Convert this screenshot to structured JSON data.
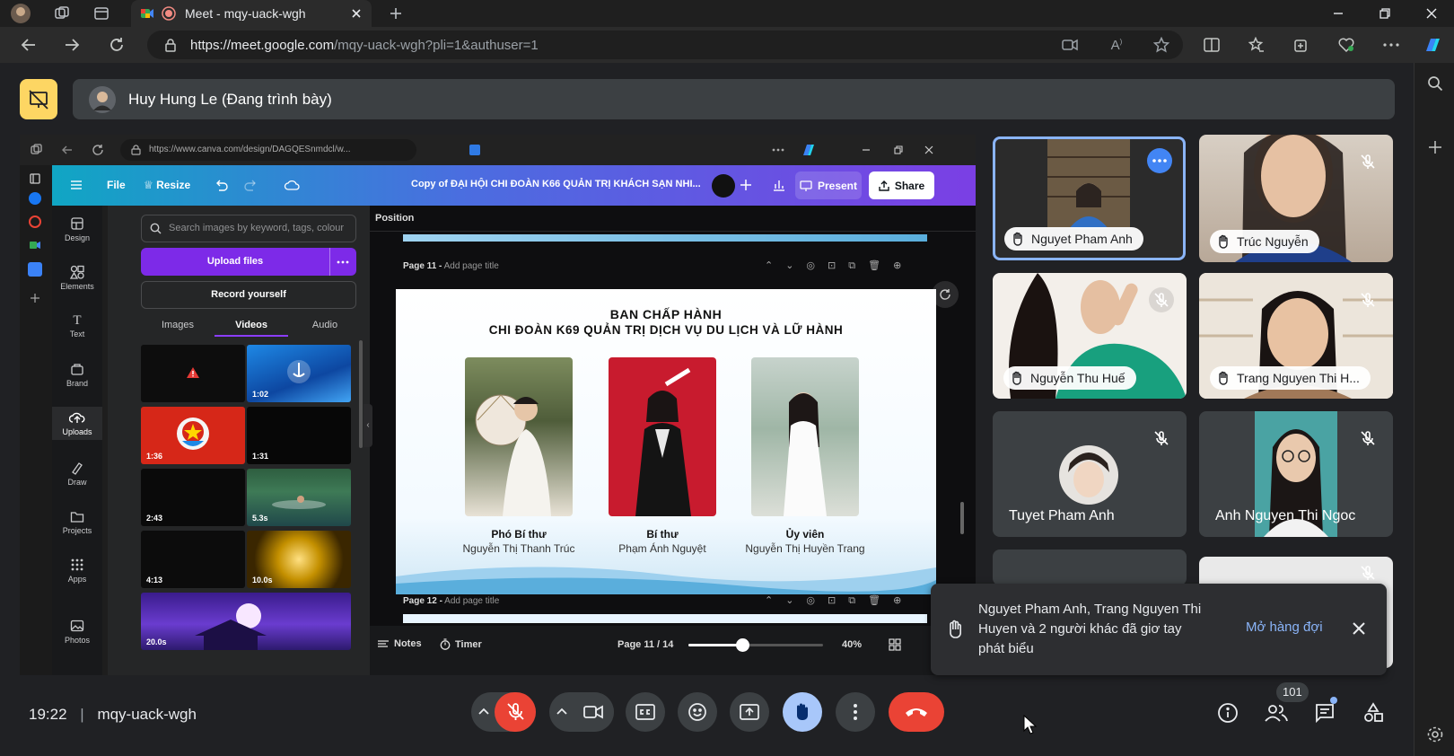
{
  "browser": {
    "tab_title": "Meet - mqy-uack-wgh",
    "url_host": "https://meet.google.com",
    "url_path": "/mqy-uack-wgh?pli=1&authuser=1"
  },
  "meet": {
    "presenter_label": "Huy Hung Le (Đang trình bày)",
    "time": "19:22",
    "separator": "|",
    "meeting_code": "mqy-uack-wgh",
    "participant_count": "101"
  },
  "canva": {
    "url": "https://www.canva.com/design/DAGQESnmdcl/w...",
    "menu": {
      "file": "File",
      "resize": "Resize"
    },
    "doc_title": "Copy of ĐẠI HỘI CHI ĐOÀN K66 QUẢN TRỊ KHÁCH SẠN NHI...",
    "present_label": "Present",
    "share_label": "Share",
    "sidebar": [
      "Design",
      "Elements",
      "Text",
      "Brand",
      "Uploads",
      "Draw",
      "Projects",
      "Apps",
      "Photos"
    ],
    "search_placeholder": "Search images by keyword, tags, colour",
    "upload_label": "Upload files",
    "record_label": "Record yourself",
    "tabs": [
      "Images",
      "Videos",
      "Audio"
    ],
    "durations": [
      "1:02",
      "1:36",
      "1:31",
      "2:43",
      "5.3s",
      "4:13",
      "10.0s",
      "20.0s"
    ],
    "position_label": "Position",
    "page11_label": "Page 11 -",
    "page12_label": "Page 12 -",
    "add_title": "Add page title",
    "notes_label": "Notes",
    "timer_label": "Timer",
    "page_counter": "Page 11 / 14",
    "zoom": "40%",
    "zoom_fraction": 0.4
  },
  "slide": {
    "title_line1": "BAN CHẤP HÀNH",
    "title_line2": "CHI ĐOÀN K69 QUẢN TRỊ DỊCH VỤ DU LỊCH VÀ LỮ HÀNH",
    "members": [
      {
        "role": "Phó Bí thư",
        "name": "Nguyễn Thị Thanh Trúc"
      },
      {
        "role": "Bí thư",
        "name": "Phạm Ánh Nguyệt"
      },
      {
        "role": "Ủy viên",
        "name": "Nguyễn Thị Huyền Trang"
      }
    ]
  },
  "participants": [
    {
      "name": "Nguyet Pham Anh"
    },
    {
      "name": "Trúc Nguyễn"
    },
    {
      "name": "Nguyễn Thu Huế"
    },
    {
      "name": "Trang Nguyen Thi H..."
    },
    {
      "name": "Tuyet Pham Anh"
    },
    {
      "name": "Anh Nguyen Thi Ngoc"
    }
  ],
  "toast": {
    "message": "Nguyet Pham Anh, Trang Nguyen Thi Huyen và 2 người khác đã giơ tay phát biểu",
    "action": "Mở hàng đợi"
  },
  "colors": {
    "hangup": "#ea4335",
    "raise_hand_active": "#a8c7fa",
    "accent_blue": "#8ab4f8",
    "banner_yellow": "#fdd663",
    "canva_purple": "#7d2ae8"
  }
}
